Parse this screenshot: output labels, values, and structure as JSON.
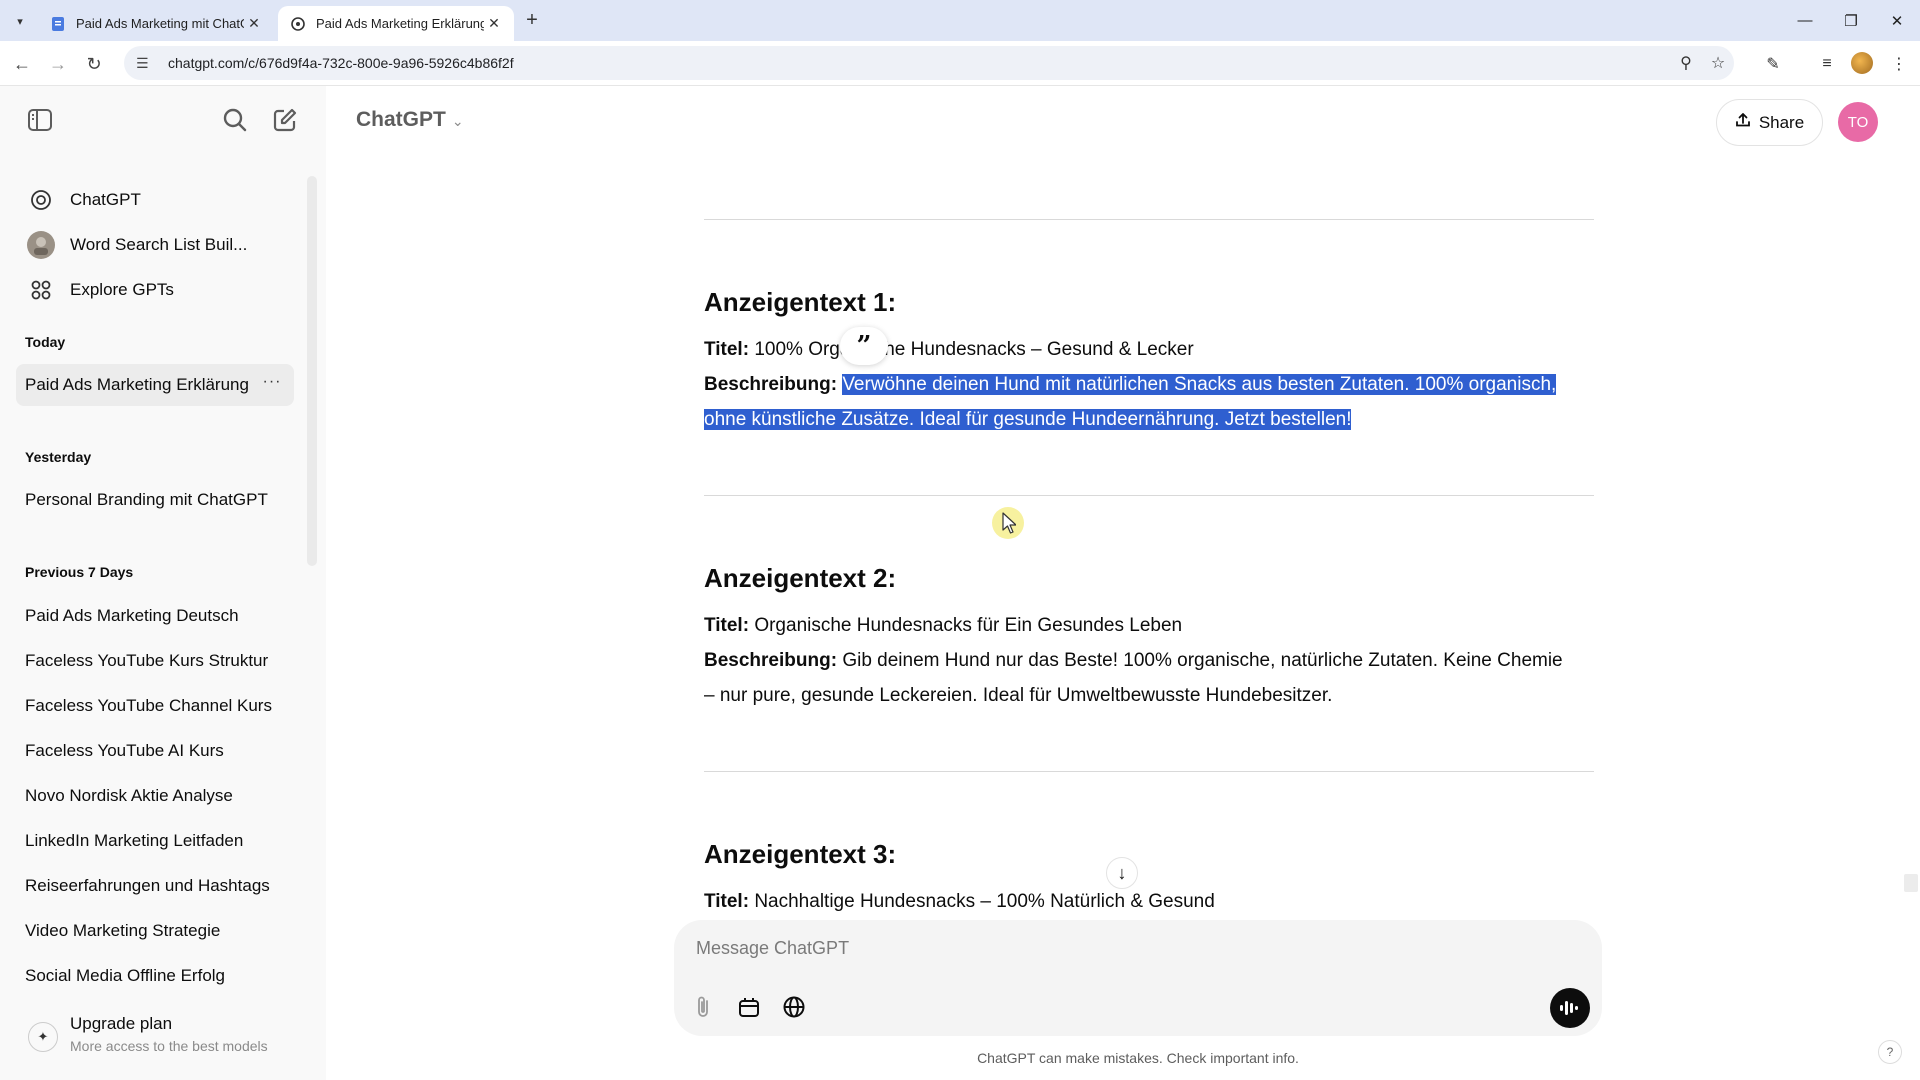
{
  "browser": {
    "tabs": [
      {
        "title": "Paid Ads Marketing mit ChatGPT",
        "active": false
      },
      {
        "title": "Paid Ads Marketing Erklärung",
        "active": true
      }
    ],
    "url": "chatgpt.com/c/676d9f4a-732c-800e-9a96-5926c4b86f2f"
  },
  "sidebar": {
    "gpts": [
      {
        "label": "ChatGPT",
        "icon": "openai-logo-icon"
      },
      {
        "label": "Word Search List Buil...",
        "icon": "gpt-avatar-icon"
      },
      {
        "label": "Explore GPTs",
        "icon": "grid-icon"
      }
    ],
    "groups": [
      {
        "label": "Today",
        "items": [
          "Paid Ads Marketing Erklärung"
        ]
      },
      {
        "label": "Yesterday",
        "items": [
          "Personal Branding mit ChatGPT"
        ]
      },
      {
        "label": "Previous 7 Days",
        "items": [
          "Paid Ads Marketing Deutsch",
          "Faceless YouTube Kurs Struktur",
          "Faceless YouTube Channel Kurs",
          "Faceless YouTube AI Kurs",
          "Novo Nordisk Aktie Analyse",
          "LinkedIn Marketing Leitfaden",
          "Reiseerfahrungen und Hashtags",
          "Video Marketing Strategie",
          "Social Media Offline Erfolg"
        ]
      }
    ],
    "active_item_more": "···",
    "upgrade": {
      "title": "Upgrade plan",
      "subtitle": "More access to the best models"
    }
  },
  "header": {
    "model": "ChatGPT",
    "share_label": "Share",
    "avatar_initials": "TO"
  },
  "content": {
    "quote_glyph": "”",
    "ads": [
      {
        "heading": "Anzeigentext 1:",
        "title_label": "Titel:",
        "title": "100% Organische Hundesnacks – Gesund & Lecker",
        "desc_label": "Beschreibung:",
        "desc_line1": "Verwöhne deinen Hund mit natürlichen Snacks aus besten Zutaten. 100% organisch,",
        "desc_line2": "ohne künstliche Zusätze. Ideal für gesunde Hundeernährung. Jetzt bestellen!"
      },
      {
        "heading": "Anzeigentext 2:",
        "title_label": "Titel:",
        "title": "Organische Hundesnacks für Ein Gesundes Leben",
        "desc_label": "Beschreibung:",
        "desc_line1": "Gib deinem Hund nur das Beste! 100% organische, natürliche Zutaten. Keine Chemie",
        "desc_line2": "– nur pure, gesunde Leckereien. Ideal für Umweltbewusste Hundebesitzer."
      },
      {
        "heading": "Anzeigentext 3:",
        "title_label": "Titel:",
        "title": "Nachhaltige Hundesnacks – 100% Natürlich & Gesund"
      }
    ]
  },
  "composer": {
    "placeholder": "Message ChatGPT",
    "disclaimer": "ChatGPT can make mistakes. Check important info."
  },
  "help_label": "?"
}
